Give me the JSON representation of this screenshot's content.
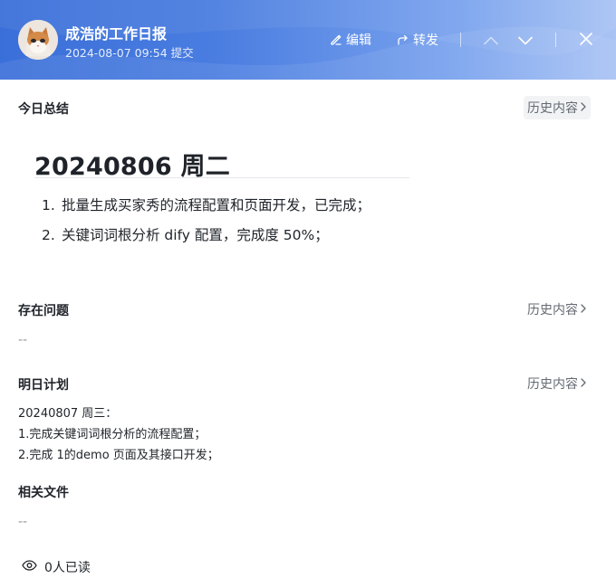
{
  "header": {
    "title": "成浩的工作日报",
    "submitted": "2024-08-07 09:54 提交",
    "edit_label": "编辑",
    "forward_label": "转发"
  },
  "sections": {
    "today": {
      "title": "今日总结",
      "history_label": "历史内容",
      "heading": "20240806 周二",
      "items": [
        {
          "num": "1.",
          "text": "批量生成买家秀的流程配置和页面开发，已完成；"
        },
        {
          "num": "2.",
          "text": "关键词词根分析 dify 配置，完成度 50%；"
        }
      ]
    },
    "issues": {
      "title": "存在问题",
      "history_label": "历史内容",
      "empty": "--"
    },
    "plan": {
      "title": "明日计划",
      "history_label": "历史内容",
      "lines": [
        "20240807 周三：",
        "1.完成关键词词根分析的流程配置；",
        "2.完成 1的demo 页面及其接口开发；"
      ]
    },
    "files": {
      "title": "相关文件",
      "empty": "--"
    }
  },
  "footer": {
    "read_count": "0人已读"
  },
  "colors": {
    "header_gradient_start": "#3a6fd9",
    "header_gradient_end": "#a9c3f4",
    "text": "#1f2329",
    "muted": "#646a73"
  },
  "icons": [
    "avatar-cat",
    "edit-icon",
    "forward-icon",
    "chevron-up-icon",
    "chevron-down-icon",
    "close-icon",
    "chevron-right-icon",
    "eye-icon"
  ]
}
